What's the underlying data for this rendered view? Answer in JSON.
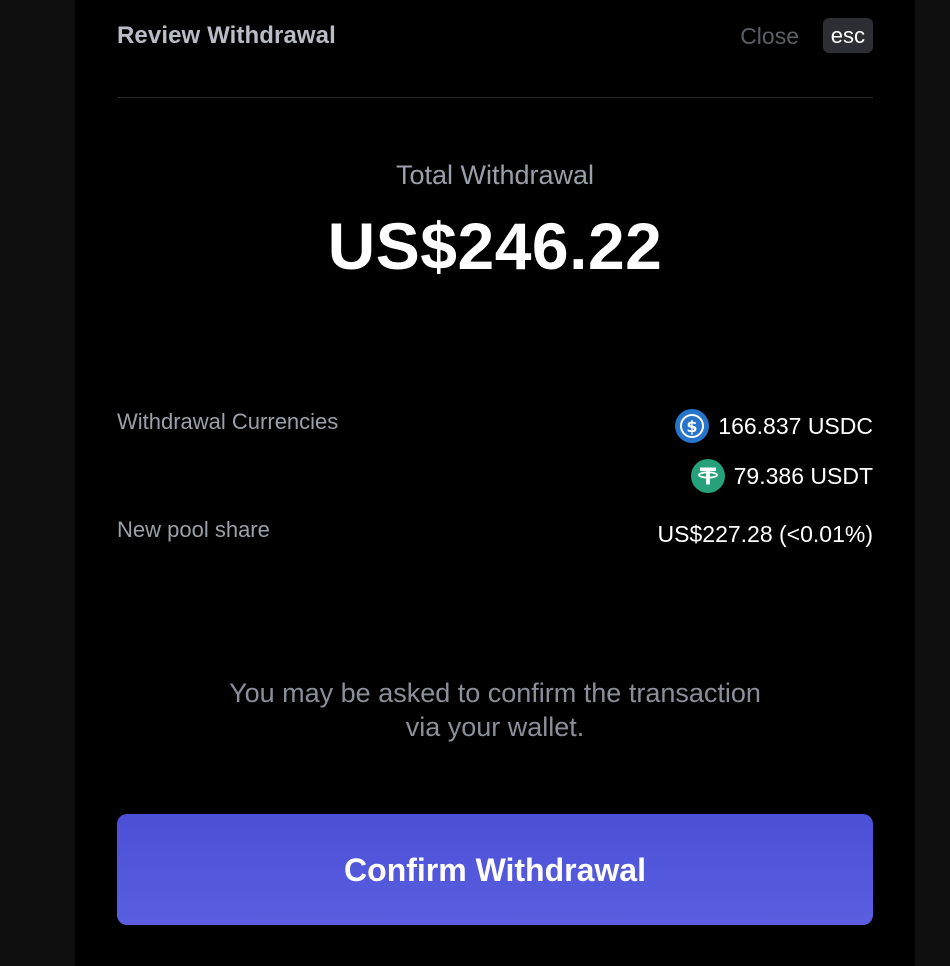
{
  "header": {
    "title": "Review Withdrawal",
    "close_label": "Close",
    "esc_label": "esc"
  },
  "summary": {
    "total_label": "Total Withdrawal",
    "total_amount": "US$246.22"
  },
  "details": {
    "currencies_label": "Withdrawal Currencies",
    "currencies": [
      {
        "amount": "166.837 USDC",
        "icon": "usdc-icon",
        "color": "#2775ca"
      },
      {
        "amount": "79.386 USDT",
        "icon": "usdt-icon",
        "color": "#26a17b"
      }
    ],
    "pool_share_label": "New pool share",
    "pool_share_value": "US$227.28 (<0.01%)"
  },
  "note": {
    "line1": "You may be asked to confirm the transaction",
    "line2": "via your wallet."
  },
  "actions": {
    "confirm_label": "Confirm Withdrawal"
  },
  "colors": {
    "accent": "#5a5fe0",
    "background": "#000000"
  }
}
